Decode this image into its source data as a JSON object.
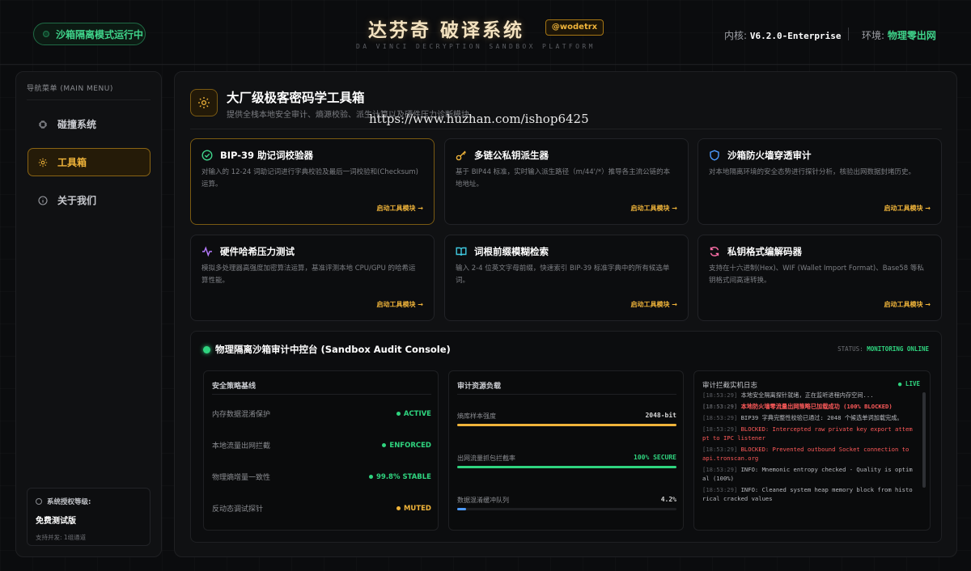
{
  "header": {
    "sandbox_status": "沙箱隔离模式运行中",
    "title": "达芬奇 破译系统",
    "tag": "@wodetrx",
    "subtitle": "DA VINCI DECRYPTION SANDBOX PLATFORM",
    "kernel_label": "内核:",
    "kernel_value": "V6.2.0-Enterprise",
    "env_label": "环境:",
    "env_value": "物理零出网"
  },
  "sidebar": {
    "title": "导航菜单 (MAIN MENU)",
    "items": [
      {
        "label": "碰撞系统",
        "icon": "chip-icon"
      },
      {
        "label": "工具箱",
        "icon": "gear-icon"
      },
      {
        "label": "关于我们",
        "icon": "info-icon"
      }
    ],
    "license_label": "系统授权等级:",
    "license_value": "免费测试版",
    "license_note": "支持并发: 1组通道"
  },
  "main": {
    "title": "大厂级极客密码学工具箱",
    "subtitle": "提供全栈本地安全审计、熵源校验、派生计算以及硬件压力诊断模块。",
    "watermark": "https://www.huzhan.com/ishop6425",
    "launch_label": "启动工具模块 →",
    "tools": [
      {
        "name": "BIP-39 助记词校验器",
        "desc": "对输入的 12-24 词助记词进行字典校验及最后一词校验和(Checksum)运算。",
        "icon": "check-circle-icon",
        "color": "#3fd38a"
      },
      {
        "name": "多链公私钥派生器",
        "desc": "基于 BIP44 标准，实时输入派生路径（m/44'/*）推导各主流公链的本地地址。",
        "icon": "key-icon",
        "color": "#f0b43a"
      },
      {
        "name": "沙箱防火墙穿透审计",
        "desc": "对本地隔离环境的安全态势进行探针分析，核验出网数据封堵历史。",
        "icon": "shield-icon",
        "color": "#4d9bff"
      },
      {
        "name": "硬件哈希压力测试",
        "desc": "模拟多处理器高强度加密算法运算，基准评测本地 CPU/GPU 的哈希运算性能。",
        "icon": "pulse-icon",
        "color": "#b77bff"
      },
      {
        "name": "词根前缀模糊检索",
        "desc": "输入 2-4 位英文字母前缀，快速索引 BIP-39 标准字典中的所有候选单词。",
        "icon": "book-icon",
        "color": "#3fc9e0"
      },
      {
        "name": "私钥格式编解码器",
        "desc": "支持在十六进制(Hex)、WIF (Wallet Import Format)、Base58 等私钥格式间高速转换。",
        "icon": "refresh-icon",
        "color": "#ff6fa8"
      }
    ]
  },
  "console": {
    "title": "物理隔离沙箱审计中控台 (Sandbox Audit Console)",
    "status_label": "STATUS:",
    "status_value": "MONITORING ONLINE",
    "policy": {
      "title": "安全策略基线",
      "rows": [
        {
          "label": "内存数据混淆保护",
          "value": "ACTIVE",
          "color": "#2fd47f"
        },
        {
          "label": "本地流量出网拦截",
          "value": "ENFORCED",
          "color": "#2fd47f"
        },
        {
          "label": "物理熵增量一致性",
          "value": "99.8% STABLE",
          "color": "#2fd47f"
        },
        {
          "label": "反动态调试探针",
          "value": "MUTED",
          "color": "#f0b43a"
        }
      ]
    },
    "load": {
      "title": "审计资源负载",
      "rows": [
        {
          "label": "熵库样本强度",
          "value": "2048-bit",
          "fraction": 1.0,
          "color": "#f0b43a"
        },
        {
          "label": "出网流量抓包拦截率",
          "value": "100% SECURE",
          "fraction": 1.0,
          "color": "#2fd47f"
        },
        {
          "label": "数据混淆缓冲队列",
          "value": "4.2%",
          "fraction": 0.042,
          "color": "#4d9bff"
        }
      ]
    },
    "log": {
      "title": "审计拦截实机日志",
      "live": "● LIVE",
      "lines": [
        {
          "time": "[18:53:29]",
          "text": "本地安全隔离探针就绪，正在监听进程内存空间...",
          "kind": "normal"
        },
        {
          "time": "[18:53:29]",
          "text": "本地防火墙零流量出网策略已加载成功 (100% BLOCKED)",
          "kind": "alert"
        },
        {
          "time": "[18:53:29]",
          "text": "BIP39 字典完整性校验已通过: 2048 个候选单词加载完成。",
          "kind": "normal"
        },
        {
          "time": "[18:53:29]",
          "text": "BLOCKED: Intercepted raw private key export attempt to IPC listener",
          "kind": "red"
        },
        {
          "time": "[18:53:29]",
          "text": "BLOCKED: Prevented outbound Socket connection to api.tronscan.org",
          "kind": "red"
        },
        {
          "time": "[18:53:29]",
          "text": "INFO: Mnemonic entropy checked - Quality is optimal (100%)",
          "kind": "normal"
        },
        {
          "time": "[18:53:29]",
          "text": "INFO: Cleaned system heap memory block from historical cracked values",
          "kind": "normal"
        }
      ]
    }
  }
}
